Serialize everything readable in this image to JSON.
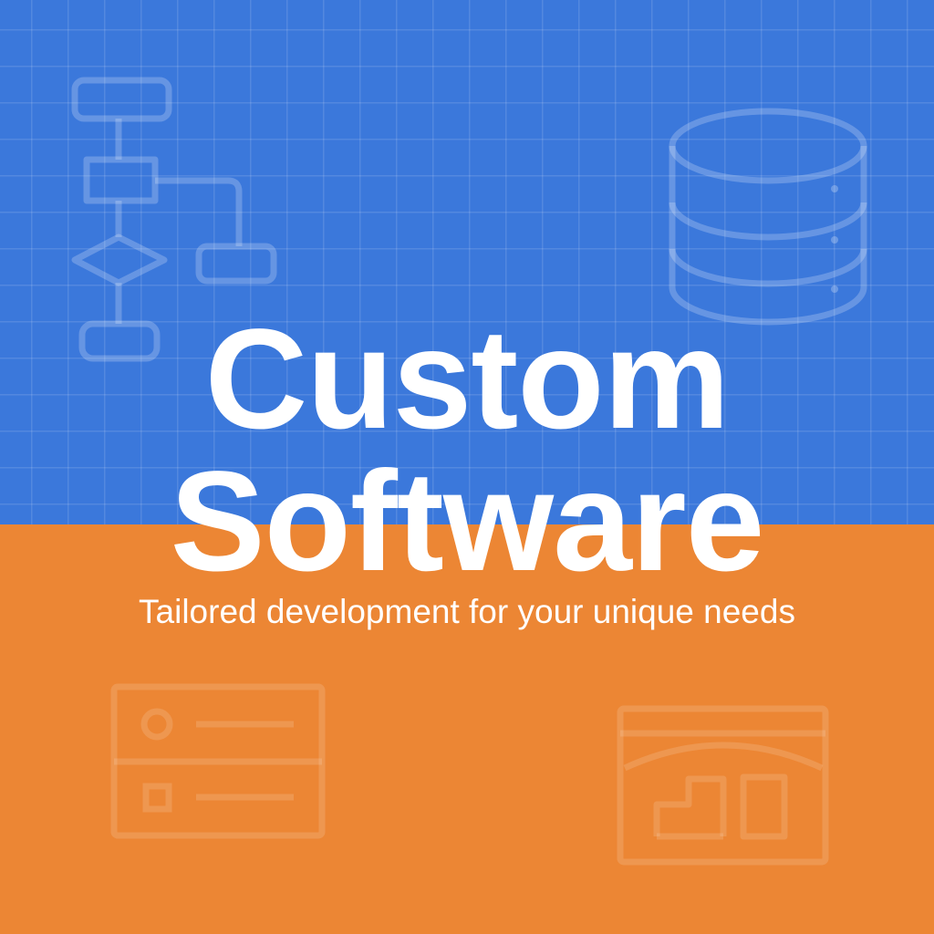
{
  "poster": {
    "title_line_1": "Custom",
    "title_line_2": "Software",
    "tagline": "Tailored development for your unique needs"
  },
  "colors": {
    "top_background": "#3b78db",
    "bottom_background": "#ec8634",
    "text": "#ffffff"
  },
  "icons": [
    "flowchart-icon",
    "database-icon",
    "form-list-icon",
    "analytics-chart-icon"
  ]
}
